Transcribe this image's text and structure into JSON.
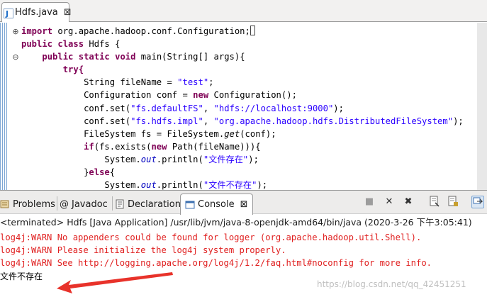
{
  "editor": {
    "tab_label": "Hdfs.java",
    "tab_close": "⊠",
    "code": {
      "l1": [
        "import",
        " org.apache.hadoop.conf.Configuration;"
      ],
      "l2": [
        "public",
        " ",
        "class",
        " Hdfs {"
      ],
      "l3": [
        "public",
        " ",
        "static",
        " ",
        "void",
        " main(String[] args){"
      ],
      "l4": "try{",
      "l5": [
        "String fileName = ",
        "\"test\"",
        ";"
      ],
      "l6": [
        "Configuration conf = ",
        "new",
        " Configuration();"
      ],
      "l7": [
        "conf.set(",
        "\"fs.defaultFS\"",
        ", ",
        "\"hdfs://localhost:9000\"",
        ");"
      ],
      "l8": [
        "conf.set(",
        "\"fs.hdfs.impl\"",
        ", ",
        "\"org.apache.hadoop.hdfs.DistributedFileSystem\"",
        ");"
      ],
      "l9": [
        "FileSystem fs = FileSystem.",
        "get",
        "(conf);"
      ],
      "l10": [
        "if",
        "(fs.exists(",
        "new",
        " Path(fileName))){"
      ],
      "l11": [
        "System.",
        "out",
        ".println(",
        "\"文件存在\"",
        ");"
      ],
      "l12": [
        "}",
        "else",
        "{"
      ],
      "l13": [
        "System.",
        "out",
        ".println(",
        "\"文件不存在\"",
        ");"
      ]
    }
  },
  "panel": {
    "tabs": [
      "Problems",
      "Javadoc",
      "Declaration",
      "Console"
    ],
    "tab_close": "⊠",
    "status": "<terminated> Hdfs [Java Application] /usr/lib/jvm/java-8-openjdk-amd64/bin/java (2020-3-26 下午3:05:41)",
    "lines": [
      "log4j:WARN No appenders could be found for logger (org.apache.hadoop.util.Shell).",
      "log4j:WARN Please initialize the log4j system properly.",
      "log4j:WARN See http://logging.apache.org/log4j/1.2/faq.html#noconfig for more info."
    ],
    "output": "文件不存在"
  },
  "watermark": "https://blog.csdn.net/qq_42451251",
  "colors": {
    "keyword": "#7f0055",
    "string": "#2a00ff",
    "warn": "#e02020",
    "arrow": "#e8322a"
  }
}
